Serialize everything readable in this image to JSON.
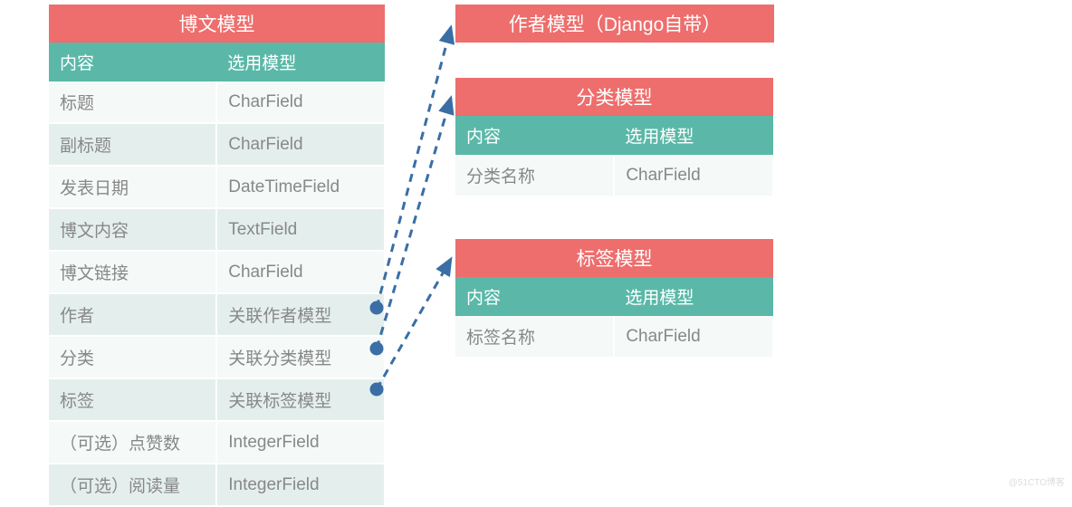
{
  "main_model": {
    "title": "博文模型",
    "headers": [
      "内容",
      "选用模型"
    ],
    "rows": [
      [
        "标题",
        "CharField"
      ],
      [
        "副标题",
        "CharField"
      ],
      [
        "发表日期",
        "DateTimeField"
      ],
      [
        "博文内容",
        "TextField"
      ],
      [
        "博文链接",
        "CharField"
      ],
      [
        "作者",
        "关联作者模型"
      ],
      [
        "分类",
        "关联分类模型"
      ],
      [
        "标签",
        "关联标签模型"
      ],
      [
        "（可选）点赞数",
        "IntegerField"
      ],
      [
        "（可选）阅读量",
        "IntegerField"
      ]
    ]
  },
  "author_model": {
    "title": "作者模型（Django自带）"
  },
  "category_model": {
    "title": "分类模型",
    "headers": [
      "内容",
      "选用模型"
    ],
    "rows": [
      [
        "分类名称",
        "CharField"
      ]
    ]
  },
  "tag_model": {
    "title": "标签模型",
    "headers": [
      "内容",
      "选用模型"
    ],
    "rows": [
      [
        "标签名称",
        "CharField"
      ]
    ]
  },
  "relations": [
    {
      "from_row": 5,
      "to": "author"
    },
    {
      "from_row": 6,
      "to": "category"
    },
    {
      "from_row": 7,
      "to": "tag"
    }
  ],
  "watermark": "@51CTO博客"
}
